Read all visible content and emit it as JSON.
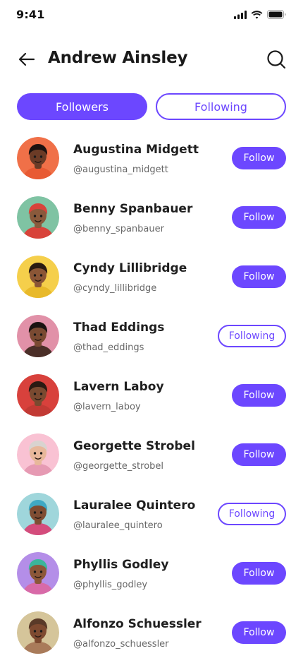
{
  "status_bar": {
    "time": "9:41"
  },
  "header": {
    "title": "Andrew Ainsley"
  },
  "tabs": [
    {
      "label": "Followers",
      "active": true
    },
    {
      "label": "Following",
      "active": false
    }
  ],
  "colors": {
    "accent": "#6c47ff"
  },
  "users": [
    {
      "name": "Augustina Midgett",
      "handle": "@augustina_midgett",
      "action": "Follow",
      "bg": "#f07048",
      "skin": "#6b3b26",
      "hair": "#1c1210",
      "shirt": "#e85a33"
    },
    {
      "name": "Benny Spanbauer",
      "handle": "@benny_spanbauer",
      "action": "Follow",
      "bg": "#7fc3a3",
      "skin": "#8a5a3c",
      "hair": "#d8433a",
      "shirt": "#d8433a"
    },
    {
      "name": "Cyndy Lillibridge",
      "handle": "@cyndy_lillibridge",
      "action": "Follow",
      "bg": "#f5cf4b",
      "skin": "#8b5636",
      "hair": "#2a1a12",
      "shirt": "#e8b92a"
    },
    {
      "name": "Thad Eddings",
      "handle": "@thad_eddings",
      "action": "Following",
      "bg": "#e191a8",
      "skin": "#7a4a32",
      "hair": "#1a1210",
      "shirt": "#4b2f28"
    },
    {
      "name": "Lavern Laboy",
      "handle": "@lavern_laboy",
      "action": "Follow",
      "bg": "#d8413c",
      "skin": "#7a4a30",
      "hair": "#2a1a12",
      "shirt": "#c23a34"
    },
    {
      "name": "Georgette Strobel",
      "handle": "@georgette_strobel",
      "action": "Follow",
      "bg": "#f9c2d3",
      "skin": "#e8b89b",
      "hair": "#d9d3cf",
      "shirt": "#e69ab3"
    },
    {
      "name": "Lauralee Quintero",
      "handle": "@lauralee_quintero",
      "action": "Following",
      "bg": "#9fd6db",
      "skin": "#7f4d33",
      "hair": "#3fa9c4",
      "shirt": "#d44c7c"
    },
    {
      "name": "Phyllis Godley",
      "handle": "@phyllis_godley",
      "action": "Follow",
      "bg": "#b48ee8",
      "skin": "#8c5739",
      "hair": "#3bb59b",
      "shirt": "#d86aa8"
    },
    {
      "name": "Alfonzo Schuessler",
      "handle": "@alfonzo_schuessler",
      "action": "Follow",
      "bg": "#d5c59a",
      "skin": "#7e4a30",
      "hair": "#5a3a28",
      "shirt": "#a97b5a"
    }
  ]
}
